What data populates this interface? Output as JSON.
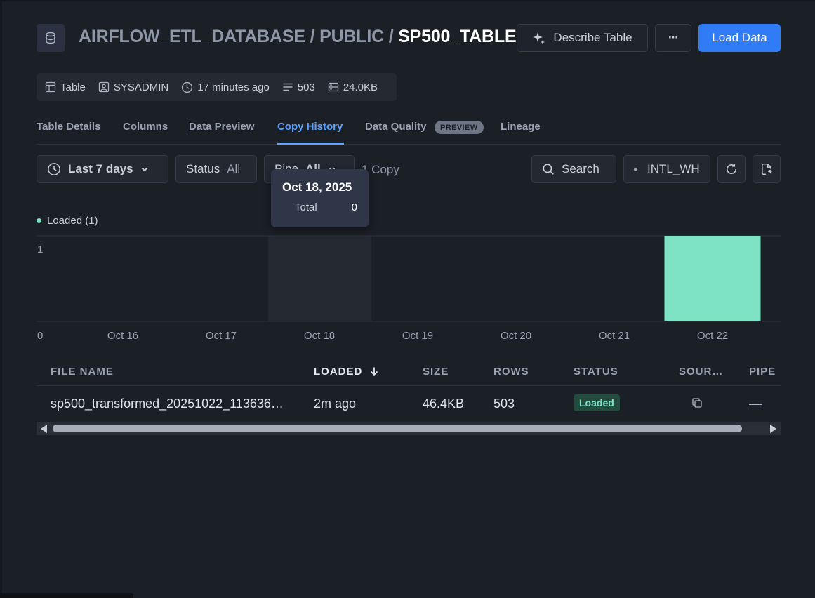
{
  "header": {
    "db_path_part1": "AIRFLOW_ETL_DATABASE",
    "separator": " / ",
    "schema": "PUBLIC",
    "table_name": "SP500_TABLE",
    "describe_label": "Describe Table",
    "more_label": "···",
    "load_label": "Load Data"
  },
  "meta": {
    "type": "Table",
    "owner": "SYSADMIN",
    "updated": "17 minutes ago",
    "rows": "503",
    "size": "24.0KB"
  },
  "tabs": [
    {
      "label": "Table Details"
    },
    {
      "label": "Columns"
    },
    {
      "label": "Data Preview"
    },
    {
      "label": "Copy History"
    },
    {
      "label": "Data Quality"
    },
    {
      "label": "Lineage"
    }
  ],
  "preview_badge": "PREVIEW",
  "filters": {
    "range": "Last 7 days",
    "status_label": "Status",
    "status_value": "All",
    "pipe_label": "Pipe",
    "pipe_value": "All",
    "copy_count": "1 Copy",
    "search_label": "Search",
    "warehouse": "INTL_WH"
  },
  "tooltip": {
    "date": "Oct 18, 2025",
    "label": "Total",
    "value": "0"
  },
  "legend": {
    "label": "Loaded (1)",
    "color": "#7ee3c4"
  },
  "chart_data": {
    "type": "bar",
    "categories": [
      "Oct 16",
      "Oct 17",
      "Oct 18",
      "Oct 19",
      "Oct 20",
      "Oct 21",
      "Oct 22"
    ],
    "series": [
      {
        "name": "Loaded",
        "values": [
          0,
          0,
          0,
          0,
          0,
          0,
          1
        ]
      }
    ],
    "ylim": [
      0,
      1
    ],
    "yticks": [
      "0",
      "1"
    ],
    "highlighted_category": "Oct 18",
    "legend_position": "top-left",
    "grid": true
  },
  "table": {
    "columns": [
      "FILE NAME",
      "LOADED",
      "SIZE",
      "ROWS",
      "STATUS",
      "SOUR…",
      "PIPE"
    ],
    "rows": [
      {
        "file_name": "sp500_transformed_20251022_113636…",
        "loaded": "2m ago",
        "size": "46.4KB",
        "rows": "503",
        "status": "Loaded",
        "pipe": "—"
      }
    ]
  }
}
